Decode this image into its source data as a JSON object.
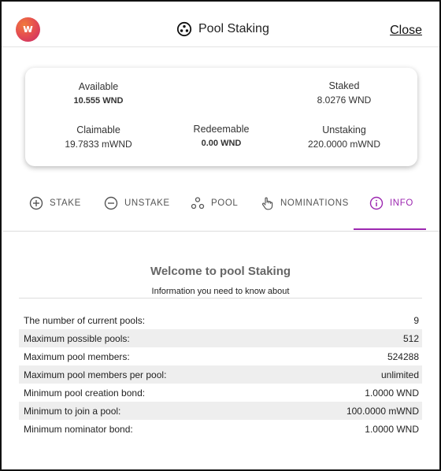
{
  "header": {
    "logo_letter": "w",
    "title": "Pool Staking",
    "close_label": "Close"
  },
  "balances": {
    "available_label": "Available",
    "available_value": "10.555 WND",
    "staked_label": "Staked",
    "staked_value": "8.0276 WND",
    "claimable_label": "Claimable",
    "claimable_value": "19.7833 mWND",
    "redeemable_label": "Redeemable",
    "redeemable_value": "0.00 WND",
    "unstaking_label": "Unstaking",
    "unstaking_value": "220.0000 mWND"
  },
  "tabs": [
    {
      "label": "STAKE",
      "icon": "add-circle-icon",
      "active": false
    },
    {
      "label": "UNSTAKE",
      "icon": "remove-circle-icon",
      "active": false
    },
    {
      "label": "POOL",
      "icon": "pool-icon",
      "active": false
    },
    {
      "label": "NOMINATIONS",
      "icon": "hand-pointer-icon",
      "active": false
    },
    {
      "label": "INFO",
      "icon": "info-icon",
      "active": true
    }
  ],
  "info": {
    "title": "Welcome to pool Staking",
    "subtitle": "Information you need to know about",
    "rows": [
      {
        "label": "The number of current pools:",
        "value": "9"
      },
      {
        "label": "Maximum possible pools:",
        "value": "512"
      },
      {
        "label": "Maximum pool members:",
        "value": "524288"
      },
      {
        "label": "Maximum pool members per pool:",
        "value": "unlimited"
      },
      {
        "label": "Minimum pool creation bond:",
        "value": "1.0000 WND"
      },
      {
        "label": "Minimum to join a pool:",
        "value": "100.0000 mWND"
      },
      {
        "label": "Minimum nominator bond:",
        "value": "1.0000 WND"
      }
    ]
  },
  "colors": {
    "accent": "#9c27b0",
    "row_shade": "#eeeeee"
  }
}
